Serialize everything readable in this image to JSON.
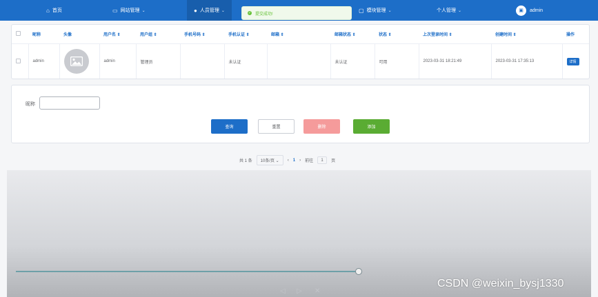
{
  "topnav": {
    "items": [
      {
        "label": "首页",
        "icon": "home-icon",
        "glyph": "⌂"
      },
      {
        "label": "网站管理",
        "icon": "cart-icon",
        "glyph": "🛒"
      },
      {
        "label": "人员管理",
        "icon": "user-icon",
        "glyph": "👤"
      },
      {
        "label": "模块管理",
        "icon": "grid-icon",
        "glyph": "▢"
      },
      {
        "label": "个人管理",
        "icon": "",
        "glyph": ""
      }
    ],
    "user": "admin",
    "chevron": "⌄"
  },
  "toast": {
    "text": "提交成功!",
    "icon_glyph": "✓"
  },
  "table": {
    "headers": [
      "昵称",
      "头像",
      "用户名 ⇕",
      "用户组 ⇕",
      "手机号码 ⇕",
      "手机认证 ⇕",
      "邮箱 ⇕",
      "邮箱状态 ⇕",
      "状态 ⇕",
      "上次登录时间 ⇕",
      "创建时间 ⇕",
      "操作"
    ],
    "rows": [
      {
        "nickname": "admin",
        "username": "admin",
        "group": "管理员",
        "phone": "",
        "phone_auth": "未认证",
        "email": "",
        "email_status": "未认证",
        "status": "可用",
        "last_login": "2023-03-31 18:21:49",
        "created": "2023-03-31 17:35:13",
        "action": "详情"
      }
    ]
  },
  "search": {
    "label": "昵称",
    "value": "",
    "buttons": {
      "query": "查询",
      "reset": "重置",
      "delete": "删除",
      "add": "添加"
    }
  },
  "pagination": {
    "total": "共 1 条",
    "page_size": "10条/页",
    "prev": "‹",
    "current": "1",
    "next": "›",
    "goto_label": "前往",
    "goto_value": "1",
    "page_suffix": "页"
  },
  "watermark": "CSDN @weixin_bysj1330",
  "colors": {
    "primary": "#1d6ec8",
    "danger": "#f59b9b",
    "success": "#5aac33"
  }
}
